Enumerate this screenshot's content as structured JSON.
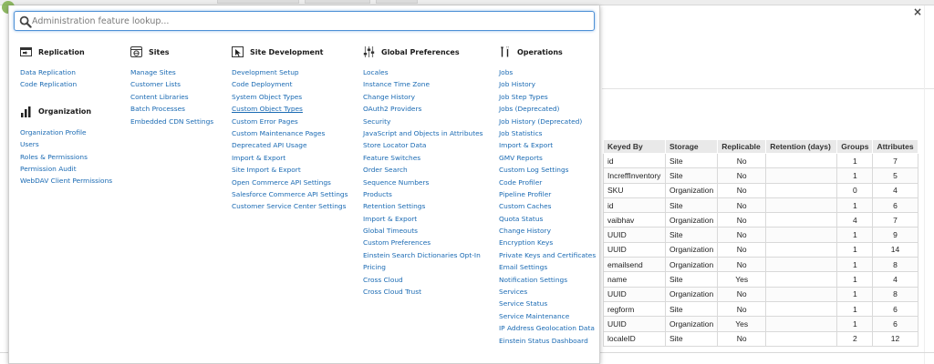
{
  "search": {
    "placeholder": "Administration feature lookup..."
  },
  "close_label": "×",
  "colors": {
    "link": "#1a6ab3",
    "search_border": "#4d90d6"
  },
  "columns": [
    {
      "sections": [
        {
          "title": "Replication",
          "icon": "replication-icon",
          "links": [
            "Data Replication",
            "Code Replication"
          ]
        },
        {
          "title": "Organization",
          "icon": "organization-chart-icon",
          "links": [
            "Organization Profile",
            "Users",
            "Roles & Permissions",
            "Permission Audit",
            "WebDAV Client Permissions"
          ]
        }
      ]
    },
    {
      "sections": [
        {
          "title": "Sites",
          "icon": "sites-icon",
          "links": [
            "Manage Sites",
            "Customer Lists",
            "Content Libraries",
            "Batch Processes",
            "Embedded CDN Settings"
          ]
        }
      ]
    },
    {
      "sections": [
        {
          "title": "Site Development",
          "icon": "site-development-icon",
          "links": [
            "Development Setup",
            "Code Deployment",
            "System Object Types",
            "Custom Object Types",
            "Custom Error Pages",
            "Custom Maintenance Pages",
            "Deprecated API Usage",
            "Import & Export",
            "Site Import & Export",
            "Open Commerce API Settings",
            "Salesforce Commerce API Settings",
            "Customer Service Center Settings"
          ]
        }
      ]
    },
    {
      "sections": [
        {
          "title": "Global Preferences",
          "icon": "global-preferences-icon",
          "links": [
            "Locales",
            "Instance Time Zone",
            "Change History",
            "OAuth2 Providers",
            "Security",
            "JavaScript and Objects in Attributes",
            "Store Locator Data",
            "Feature Switches",
            "Order Search",
            "Sequence Numbers",
            "Products",
            "Retention Settings",
            "Import & Export",
            "Global Timeouts",
            "Custom Preferences",
            "Einstein Search Dictionaries Opt-In",
            "Pricing",
            "Cross Cloud",
            "Cross Cloud Trust"
          ]
        }
      ]
    },
    {
      "sections": [
        {
          "title": "Operations",
          "icon": "operations-icon",
          "links": [
            "Jobs",
            "Job History",
            "Job Step Types",
            "Jobs (Deprecated)",
            "Job History (Deprecated)",
            "Job Statistics",
            "Import & Export",
            "GMV Reports",
            "Custom Log Settings",
            "Code Profiler",
            "Pipeline Profiler",
            "Custom Caches",
            "Quota Status",
            "Change History",
            "Encryption Keys",
            "Private Keys and Certificates",
            "Email Settings",
            "Notification Settings",
            "Services",
            "Service Status",
            "Service Maintenance",
            "IP Address Geolocation Data",
            "Einstein Status Dashboard"
          ]
        }
      ]
    }
  ],
  "table": {
    "headers": [
      "Keyed By",
      "Storage",
      "Replicable",
      "Retention (days)",
      "Groups",
      "Attributes"
    ],
    "rows": [
      [
        "id",
        "Site",
        "No",
        "",
        "1",
        "7"
      ],
      [
        "IncreffInventory",
        "Site",
        "No",
        "",
        "1",
        "5"
      ],
      [
        "SKU",
        "Organization",
        "No",
        "",
        "0",
        "4"
      ],
      [
        "id",
        "Site",
        "No",
        "",
        "1",
        "6"
      ],
      [
        "vaibhav",
        "Organization",
        "No",
        "",
        "4",
        "7"
      ],
      [
        "UUID",
        "Site",
        "No",
        "",
        "1",
        "9"
      ],
      [
        "UUID",
        "Organization",
        "No",
        "",
        "1",
        "14"
      ],
      [
        "emailsend",
        "Organization",
        "No",
        "",
        "1",
        "8"
      ],
      [
        "name",
        "Site",
        "Yes",
        "",
        "1",
        "4"
      ],
      [
        "UUID",
        "Organization",
        "No",
        "",
        "1",
        "8"
      ],
      [
        "regform",
        "Site",
        "No",
        "",
        "1",
        "6"
      ],
      [
        "UUID",
        "Organization",
        "Yes",
        "",
        "1",
        "6"
      ],
      [
        "localeID",
        "Site",
        "No",
        "",
        "2",
        "12"
      ]
    ]
  }
}
